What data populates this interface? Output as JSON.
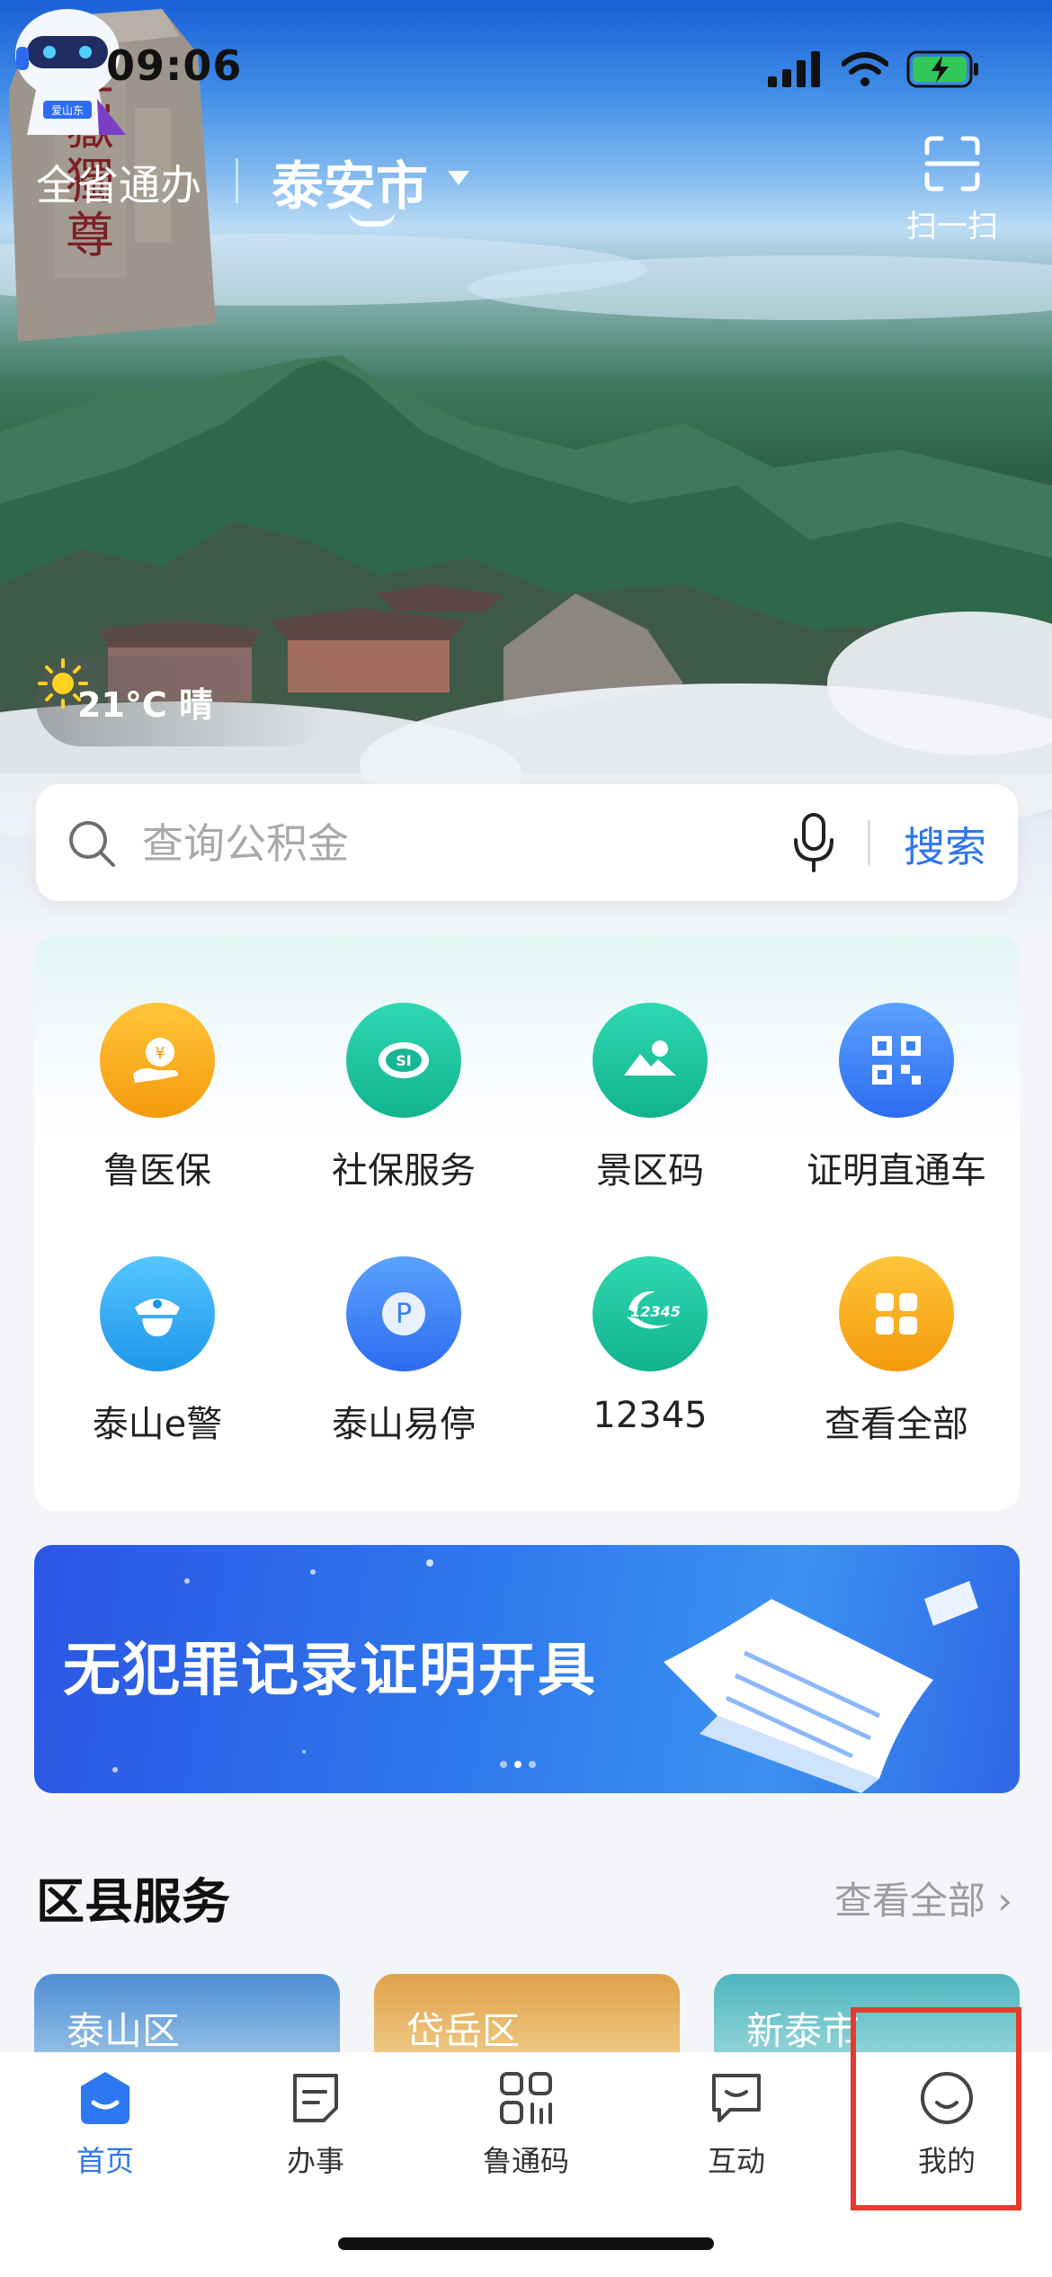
{
  "status_bar": {
    "time": "09:06"
  },
  "header": {
    "province_label": "全省通办",
    "city": "泰安市",
    "scan_label": "扫一扫"
  },
  "hero": {
    "weather": "21°C 晴",
    "monument_text": "五嶽獨尊",
    "mascot_badge": "爱山东"
  },
  "search": {
    "placeholder": "查询公积金",
    "button": "搜索"
  },
  "services": [
    {
      "label": "鲁医保",
      "icon": "medical-insurance-icon",
      "color": "#f7a51b"
    },
    {
      "label": "社保服务",
      "icon": "social-security-icon",
      "color": "#19c4a0"
    },
    {
      "label": "景区码",
      "icon": "scenic-code-icon",
      "color": "#19c4a0"
    },
    {
      "label": "证明直通车",
      "icon": "certificate-icon",
      "color": "#3a80f0"
    },
    {
      "label": "泰山e警",
      "icon": "police-icon",
      "color": "#2ea7ee"
    },
    {
      "label": "泰山易停",
      "icon": "parking-icon",
      "color": "#3a80f0"
    },
    {
      "label": "12345",
      "icon": "hotline-icon",
      "color": "#19c4a0"
    },
    {
      "label": "查看全部",
      "icon": "grid-all-icon",
      "color": "#f7a51b"
    }
  ],
  "promo": {
    "title": "无犯罪记录证明开具"
  },
  "district_section": {
    "title": "区县服务",
    "more": "查看全部",
    "items": [
      "泰山区",
      "岱岳区",
      "新泰市"
    ]
  },
  "tabbar": {
    "tabs": [
      {
        "label": "首页",
        "active": true
      },
      {
        "label": "办事",
        "active": false
      },
      {
        "label": "鲁通码",
        "active": false
      },
      {
        "label": "互动",
        "active": false
      },
      {
        "label": "我的",
        "active": false
      }
    ]
  }
}
